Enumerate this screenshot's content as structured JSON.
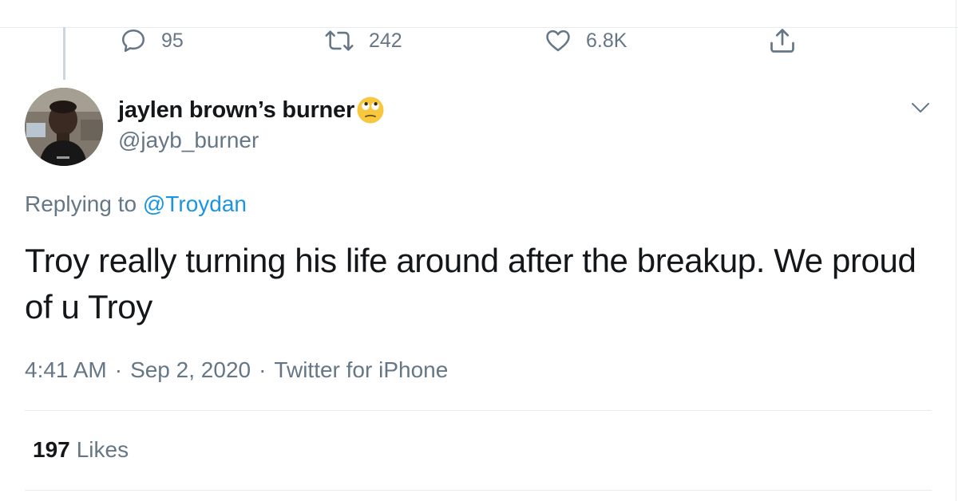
{
  "previous_tweet_actions": {
    "reply": {
      "icon": "reply-icon",
      "count": "95"
    },
    "retweet": {
      "icon": "retweet-icon",
      "count": "242"
    },
    "like": {
      "icon": "heart-icon",
      "count": "6.8K"
    },
    "share": {
      "icon": "share-icon"
    }
  },
  "tweet": {
    "display_name": "jaylen brown’s burner",
    "name_emoji": "face-with-rolling-eyes",
    "handle": "@jayb_burner",
    "replying_prefix": "Replying to",
    "replying_to": "@Troydan",
    "text": "Troy really turning his life around after the breakup. We proud of u Troy",
    "time": "4:41 AM",
    "date": "Sep 2, 2020",
    "source": "Twitter for iPhone",
    "separator": "·",
    "likes_count": "197",
    "likes_label": "Likes"
  },
  "colors": {
    "text": "#14171a",
    "secondary": "#657786",
    "link": "#1b95e0",
    "border": "#e6ecf0"
  }
}
